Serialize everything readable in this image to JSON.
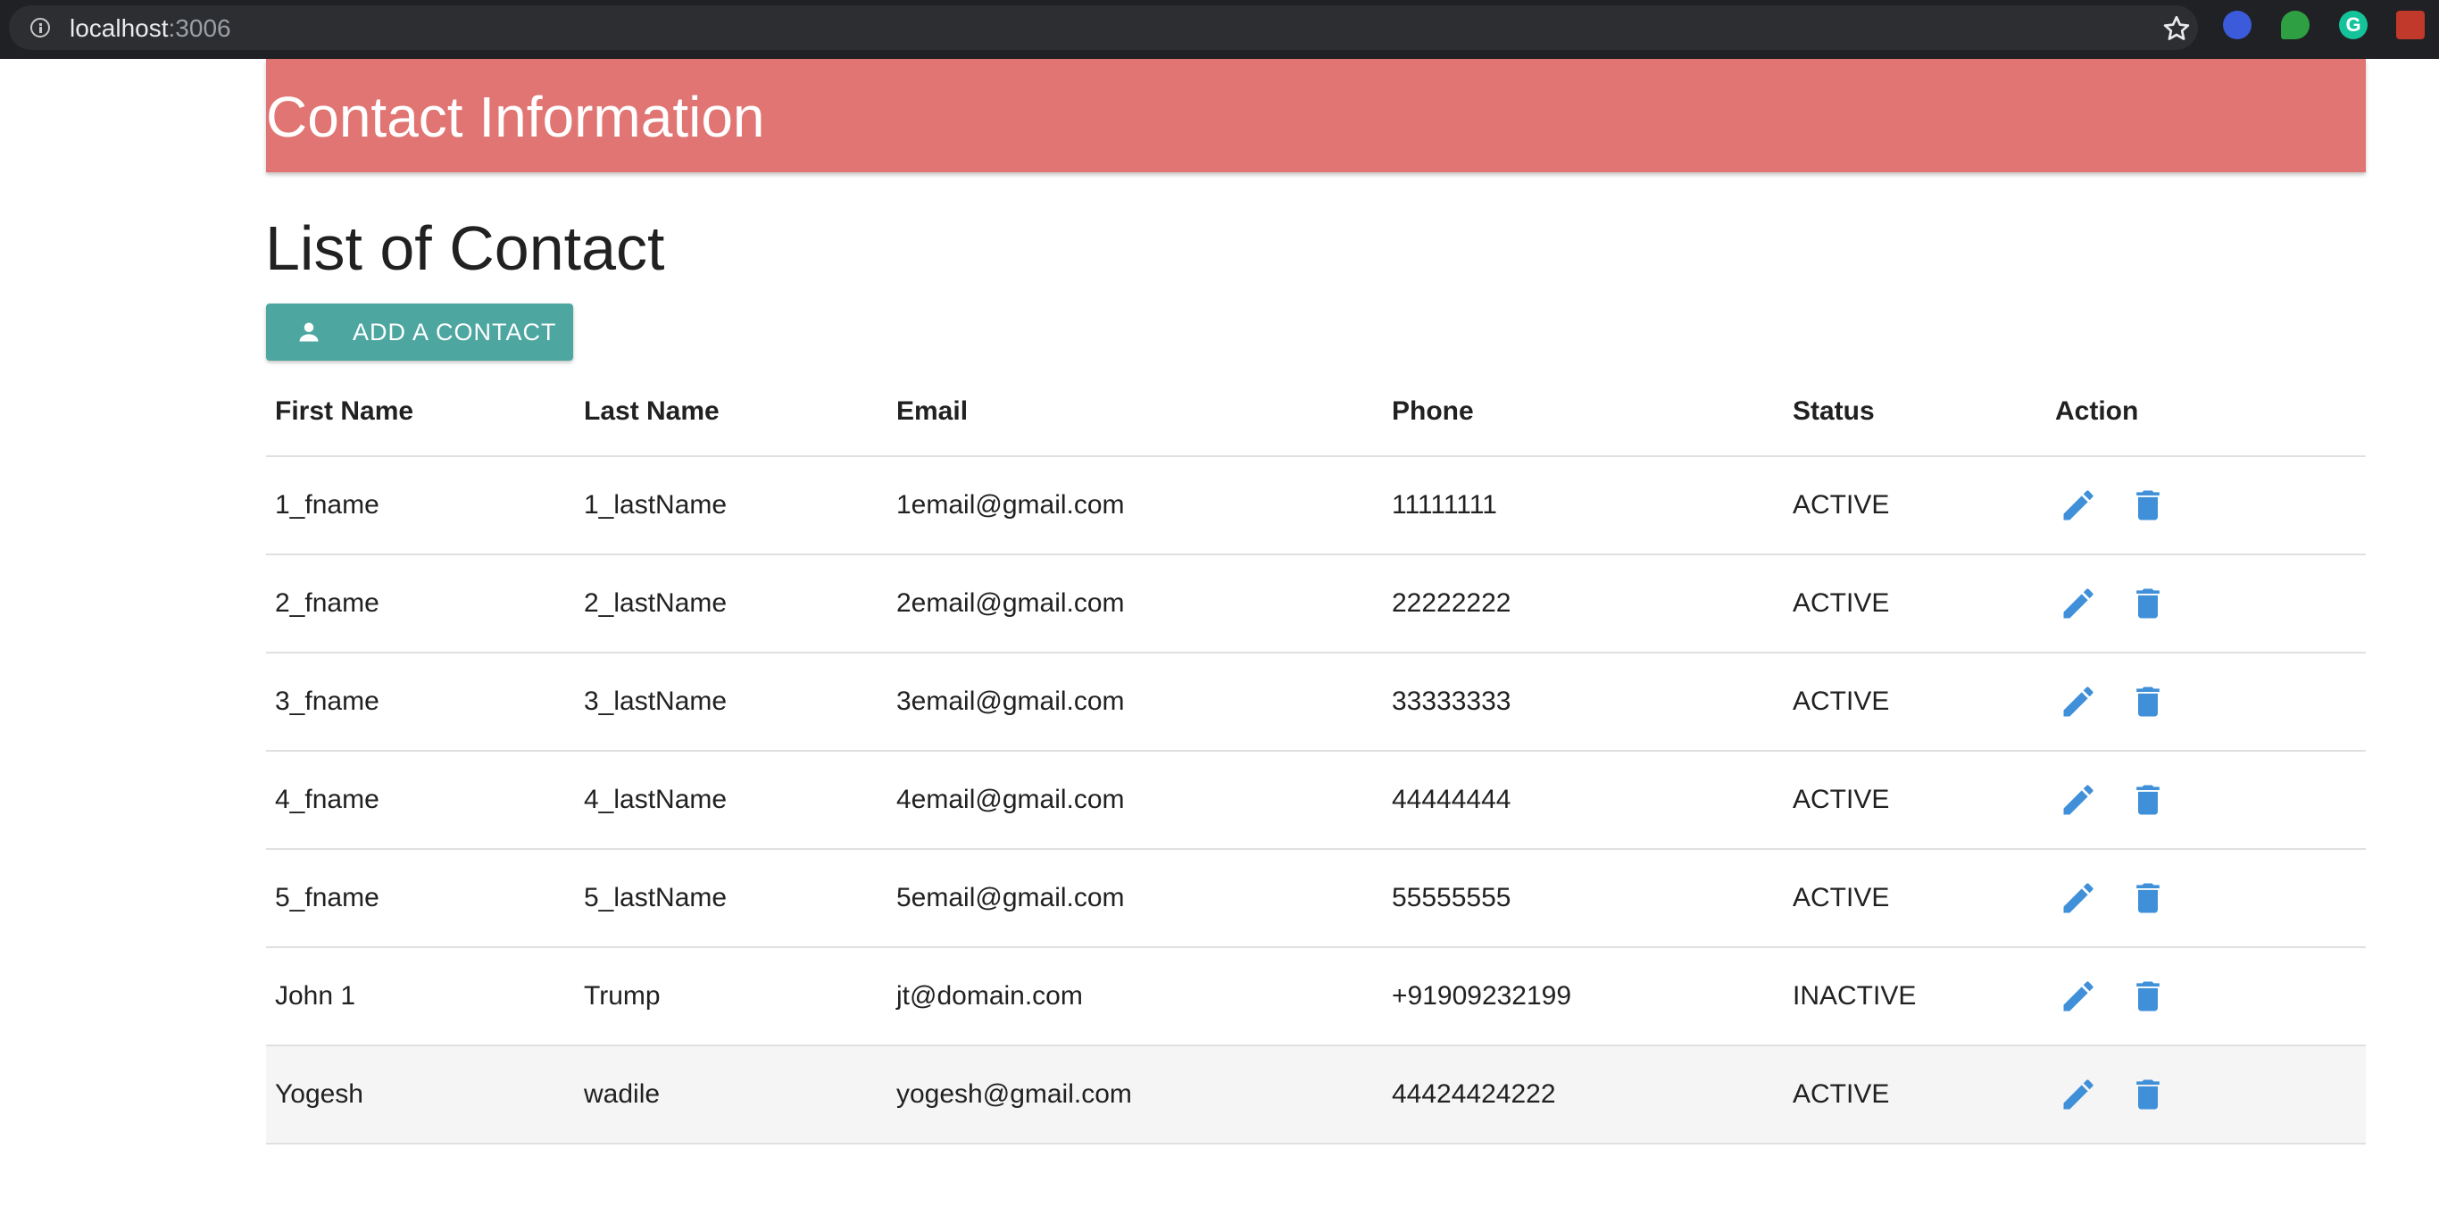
{
  "browser": {
    "url_host": "localhost",
    "url_port": ":3006"
  },
  "header": {
    "title": "Contact Information"
  },
  "list": {
    "heading": "List of Contact",
    "add_button_label": "ADD A CONTACT"
  },
  "colors": {
    "header_bg": "#e07573",
    "button_bg": "#4da6a0",
    "icon_blue": "#3f90d9"
  },
  "table": {
    "headers": {
      "first_name": "First Name",
      "last_name": "Last Name",
      "email": "Email",
      "phone": "Phone",
      "status": "Status",
      "action": "Action"
    },
    "rows": [
      {
        "first_name": "1_fname",
        "last_name": "1_lastName",
        "email": "1email@gmail.com",
        "phone": "11111111",
        "status": "ACTIVE"
      },
      {
        "first_name": "2_fname",
        "last_name": "2_lastName",
        "email": "2email@gmail.com",
        "phone": "22222222",
        "status": "ACTIVE"
      },
      {
        "first_name": "3_fname",
        "last_name": "3_lastName",
        "email": "3email@gmail.com",
        "phone": "33333333",
        "status": "ACTIVE"
      },
      {
        "first_name": "4_fname",
        "last_name": "4_lastName",
        "email": "4email@gmail.com",
        "phone": "44444444",
        "status": "ACTIVE"
      },
      {
        "first_name": "5_fname",
        "last_name": "5_lastName",
        "email": "5email@gmail.com",
        "phone": "55555555",
        "status": "ACTIVE"
      },
      {
        "first_name": "John 1",
        "last_name": "Trump",
        "email": "jt@domain.com",
        "phone": "+91909232199",
        "status": "INACTIVE"
      },
      {
        "first_name": "Yogesh",
        "last_name": "wadile",
        "email": "yogesh@gmail.com",
        "phone": "44424424222",
        "status": "ACTIVE"
      }
    ]
  }
}
